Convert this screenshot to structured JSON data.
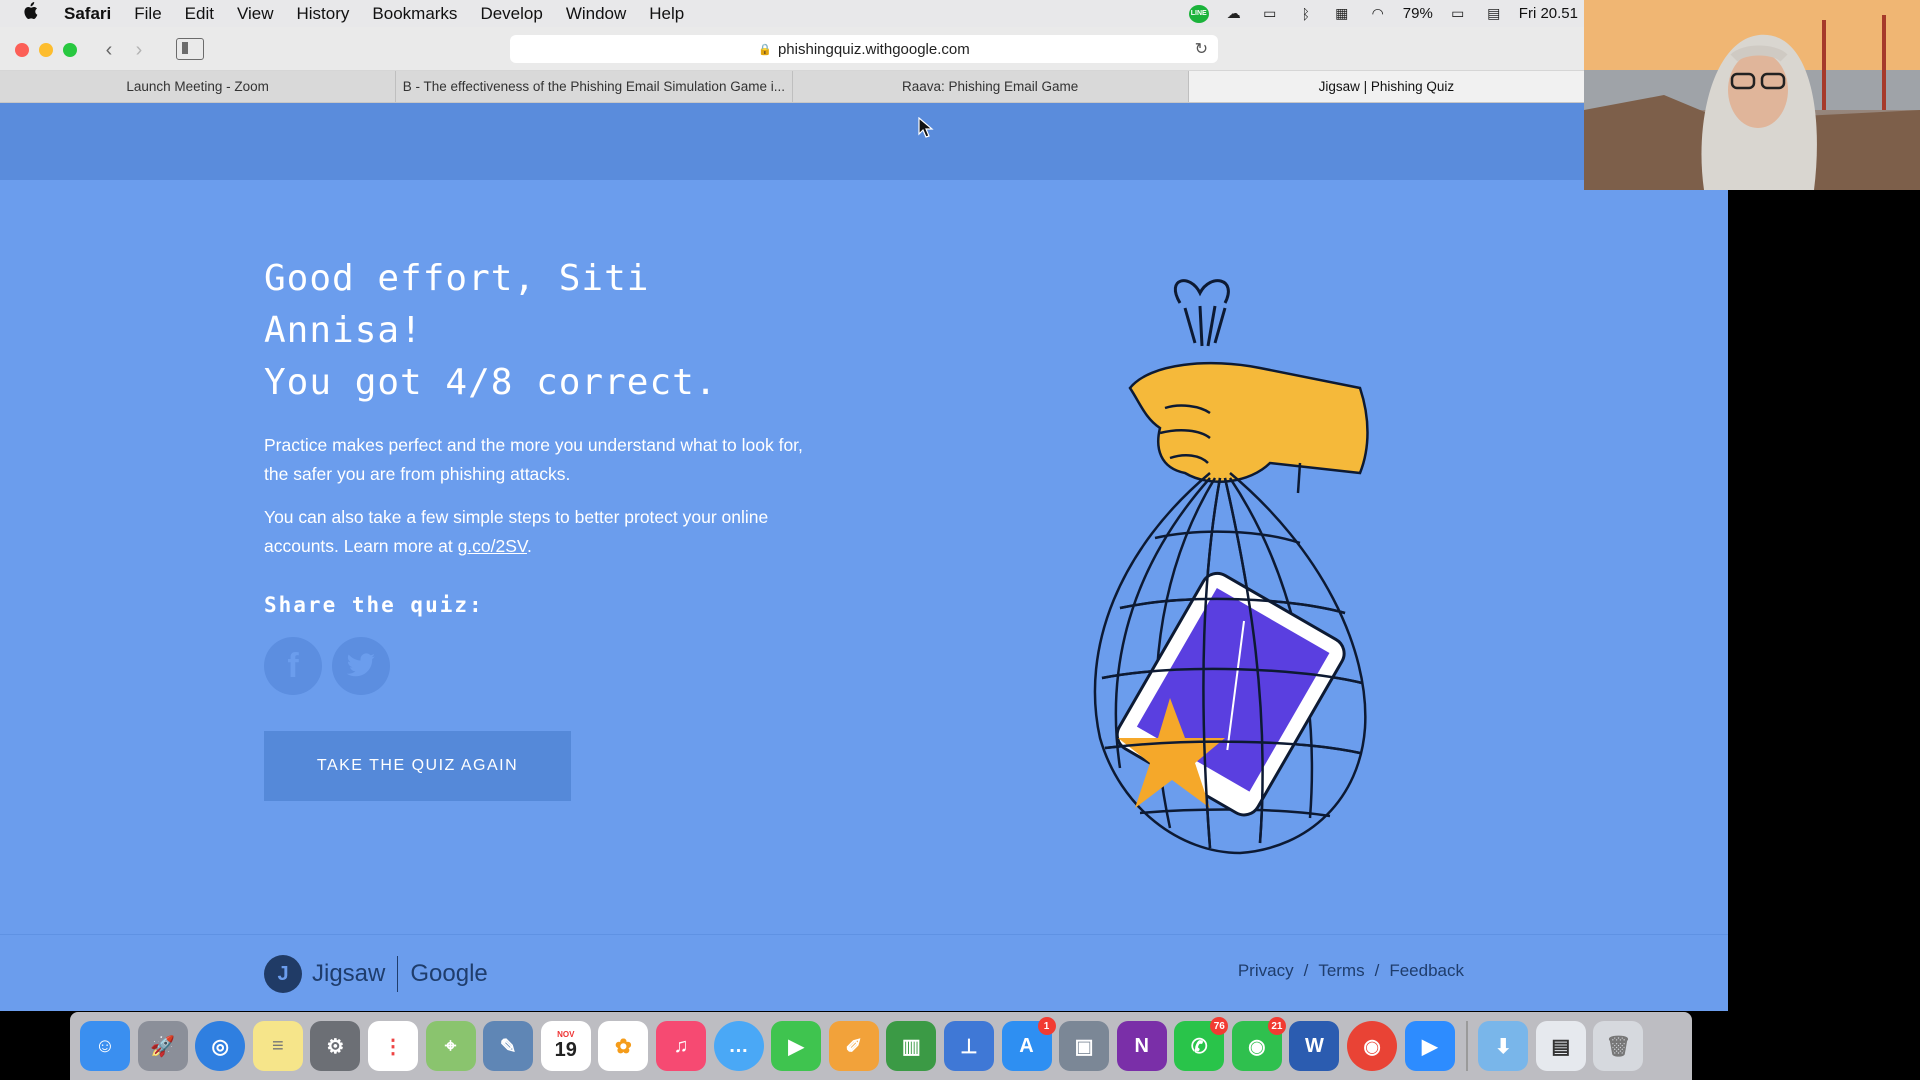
{
  "menubar": {
    "apple": "",
    "items": [
      "Safari",
      "File",
      "Edit",
      "View",
      "History",
      "Bookmarks",
      "Develop",
      "Window",
      "Help"
    ],
    "status": {
      "line_icon": "LINE",
      "battery": "79%",
      "clock": "Fri 20.51"
    }
  },
  "browser": {
    "url": "phishingquiz.withgoogle.com",
    "tabs": [
      {
        "label": "Launch Meeting - Zoom"
      },
      {
        "label": "B - The effectiveness of the Phishing Email Simulation Game i..."
      },
      {
        "label": "Raava: Phishing Email Game"
      },
      {
        "label": "Jigsaw | Phishing Quiz"
      }
    ]
  },
  "page": {
    "headline_line1": "Good effort, Siti",
    "headline_line2": "Annisa!",
    "headline_line3": "You got 4/8 correct.",
    "para1": "Practice makes perfect and the more you understand what to look for, the safer you are from phishing attacks.",
    "para2_prefix": "You can also take a few simple steps to better protect your online accounts. Learn more at ",
    "para2_link": "g.co/2SV",
    "para2_suffix": ".",
    "share_label": "Share the quiz:",
    "facebook_glyph": "f",
    "twitter_glyph": "t",
    "retake_button": "TAKE THE QUIZ AGAIN"
  },
  "footer": {
    "jigsaw": "Jigsaw",
    "google": "Google",
    "links": [
      "Privacy",
      "/",
      "Terms",
      "/",
      "Feedback"
    ]
  },
  "dock": {
    "badges": {
      "appstore": "1",
      "whatsapp": "76",
      "line": "21"
    },
    "calendar_month": "NOV",
    "calendar_day": "19",
    "onenote_letter": "N",
    "word_letter": "W"
  },
  "colors": {
    "page_bg": "#6b9ded",
    "header_bg": "#5a8cdc",
    "accent_button": "#5589d9",
    "footer_text": "#1f3d6c"
  }
}
